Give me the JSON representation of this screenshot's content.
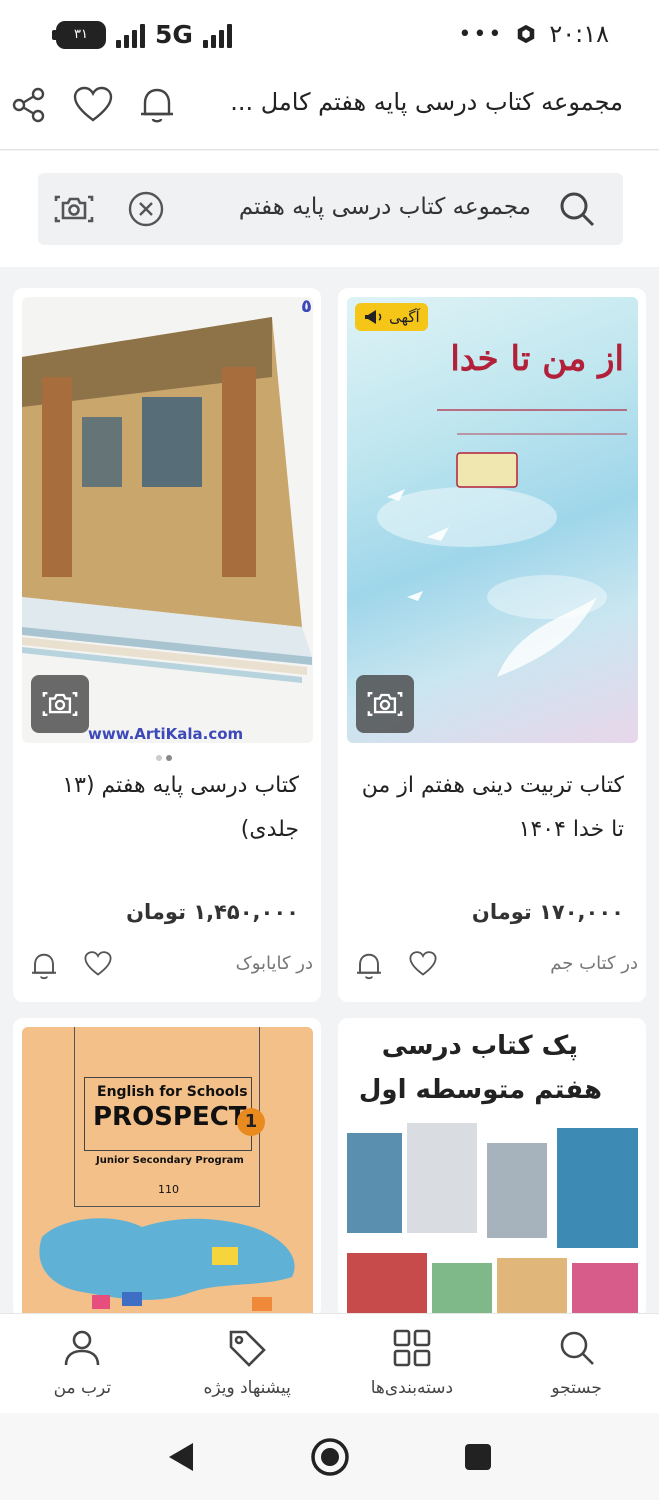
{
  "status_bar": {
    "battery": "۳۱",
    "network": "5G",
    "menu_dots": "•••",
    "time": "۲۰:۱۸"
  },
  "header": {
    "title": "مجموعه کتاب درسی پایه هفتم کامل ...",
    "icons": [
      "share-icon",
      "heart-icon",
      "bell-icon"
    ]
  },
  "search": {
    "query": "مجموعه کتاب درسی پایه هفتم",
    "icons": [
      "search-icon",
      "clear-icon",
      "camera-search-icon"
    ]
  },
  "products": [
    {
      "title": "کتاب تربیت دینی هفتم از من تا خدا ۱۴۰۴",
      "price": "۱۷۰,۰۰۰ تومان",
      "seller": "در کتاب جم",
      "ad_label": "آگهی",
      "cover_text": "از من تا خدا"
    },
    {
      "title": "کتاب درسی پایه هفتم (۱۳ جلدی)",
      "price": "۱,۴۵۰,۰۰۰ تومان",
      "seller": "در کایابوک",
      "watermark": "www.ArtiKala.com",
      "corner_mark": "٥"
    },
    {
      "cover_line1": "پک کتاب درسی",
      "cover_line2": "هفتم متوسطه اول"
    },
    {
      "cover_subtitle": "English for Schools",
      "cover_title": "PROSPECT",
      "cover_number": "1",
      "cover_program": "Junior Secondary Program",
      "cover_code": "110"
    }
  ],
  "bottom_nav": [
    {
      "label": "جستجو",
      "icon": "search-icon"
    },
    {
      "label": "دسته‌بندی‌ها",
      "icon": "grid-icon"
    },
    {
      "label": "پیشنهاد ویژه",
      "icon": "tag-icon"
    },
    {
      "label": "ترب من",
      "icon": "user-icon"
    }
  ],
  "colors": {
    "ad_badge": "#f5c518",
    "background": "#f2f3f5",
    "card": "#ffffff"
  }
}
